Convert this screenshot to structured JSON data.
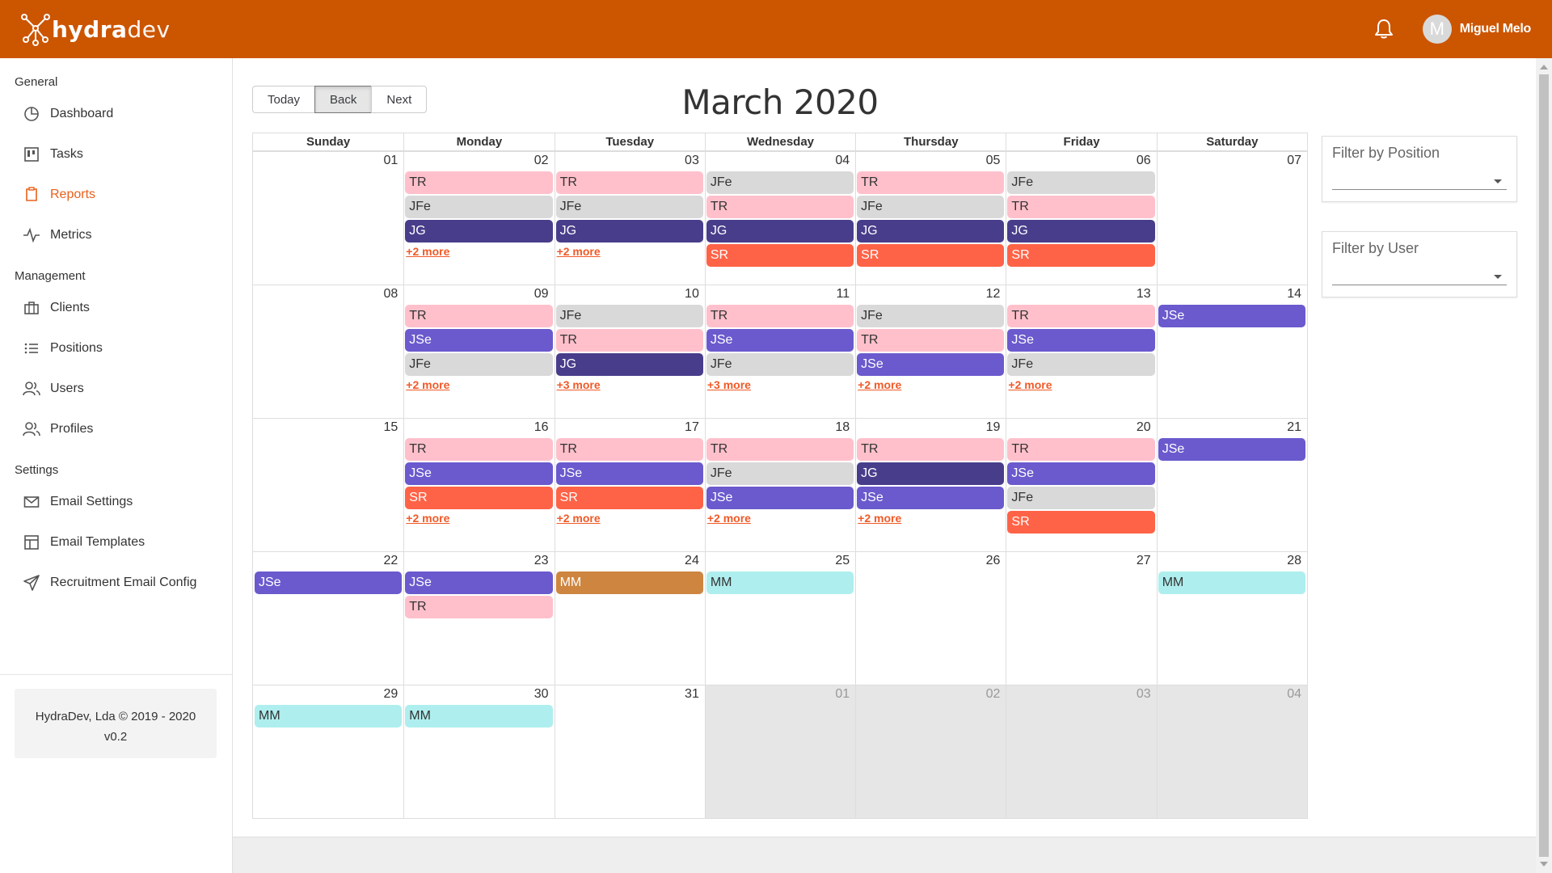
{
  "header": {
    "logo_bold": "hydra",
    "logo_light": "dev",
    "user_initial": "M",
    "user_name": "Miguel Melo"
  },
  "sidebar": {
    "sections": [
      {
        "title": "General",
        "items": [
          {
            "label": "Dashboard",
            "icon": "pie-chart-icon"
          },
          {
            "label": "Tasks",
            "icon": "kanban-icon"
          },
          {
            "label": "Reports",
            "icon": "report-icon",
            "active": true
          },
          {
            "label": "Metrics",
            "icon": "activity-icon"
          }
        ]
      },
      {
        "title": "Management",
        "items": [
          {
            "label": "Clients",
            "icon": "briefcase-icon"
          },
          {
            "label": "Positions",
            "icon": "list-icon"
          },
          {
            "label": "Users",
            "icon": "users-icon"
          },
          {
            "label": "Profiles",
            "icon": "users-icon"
          }
        ]
      },
      {
        "title": "Settings",
        "items": [
          {
            "label": "Email Settings",
            "icon": "mail-icon"
          },
          {
            "label": "Email Templates",
            "icon": "template-icon"
          },
          {
            "label": "Recruitment Email Config",
            "icon": "send-icon"
          }
        ]
      }
    ],
    "footer_line1": "HydraDev, Lda © 2019 - 2020",
    "footer_line2": "v0.2"
  },
  "toolbar": {
    "today_label": "Today",
    "back_label": "Back",
    "next_label": "Next",
    "title": "March 2020"
  },
  "filters": {
    "position_label": "Filter by Position",
    "user_label": "Filter by User"
  },
  "colors": {
    "accent": "#cc5500",
    "TR": "#ffc0cb",
    "JFe": "#d9d9d9",
    "JG": "#483d8b",
    "SR": "#ff6347",
    "JSe": "#6a5acd",
    "MM_cyan": "#afeeee",
    "MM_orange": "#cd853f"
  },
  "calendar": {
    "weekdays": [
      "Sunday",
      "Monday",
      "Tuesday",
      "Wednesday",
      "Thursday",
      "Friday",
      "Saturday"
    ],
    "weeks": [
      [
        {
          "num": "01",
          "events": []
        },
        {
          "num": "02",
          "events": [
            "TR",
            "JFe",
            "JG"
          ],
          "more": "+2 more"
        },
        {
          "num": "03",
          "events": [
            "TR",
            "JFe",
            "JG"
          ],
          "more": "+2 more"
        },
        {
          "num": "04",
          "events": [
            "JFe",
            "TR",
            "JG",
            "SR"
          ]
        },
        {
          "num": "05",
          "events": [
            "TR",
            "JFe",
            "JG",
            "SR"
          ]
        },
        {
          "num": "06",
          "events": [
            "JFe",
            "TR",
            "JG",
            "SR"
          ]
        },
        {
          "num": "07",
          "events": []
        }
      ],
      [
        {
          "num": "08",
          "events": []
        },
        {
          "num": "09",
          "events": [
            "TR",
            "JSe",
            "JFe"
          ],
          "more": "+2 more"
        },
        {
          "num": "10",
          "events": [
            "JFe",
            "TR",
            "JG"
          ],
          "more": "+3 more"
        },
        {
          "num": "11",
          "events": [
            "TR",
            "JSe",
            "JFe"
          ],
          "more": "+3 more"
        },
        {
          "num": "12",
          "events": [
            "JFe",
            "TR",
            "JSe"
          ],
          "more": "+2 more"
        },
        {
          "num": "13",
          "events": [
            "TR",
            "JSe",
            "JFe"
          ],
          "more": "+2 more"
        },
        {
          "num": "14",
          "events": [
            "JSe"
          ]
        }
      ],
      [
        {
          "num": "15",
          "events": []
        },
        {
          "num": "16",
          "events": [
            "TR",
            "JSe",
            "SR"
          ],
          "more": "+2 more"
        },
        {
          "num": "17",
          "events": [
            "TR",
            "JSe",
            "SR"
          ],
          "more": "+2 more"
        },
        {
          "num": "18",
          "events": [
            "TR",
            "JFe",
            "JSe"
          ],
          "more": "+2 more"
        },
        {
          "num": "19",
          "events": [
            "TR",
            "JG",
            "JSe"
          ],
          "more": "+2 more"
        },
        {
          "num": "20",
          "events": [
            "TR",
            "JSe",
            "JFe",
            "SR"
          ]
        },
        {
          "num": "21",
          "events": [
            "JSe"
          ]
        }
      ],
      [
        {
          "num": "22",
          "events": [
            "JSe"
          ]
        },
        {
          "num": "23",
          "events": [
            "JSe",
            "TR"
          ]
        },
        {
          "num": "24",
          "events": [
            "MM_orange"
          ]
        },
        {
          "num": "25",
          "events": [
            "MM"
          ]
        },
        {
          "num": "26",
          "events": []
        },
        {
          "num": "27",
          "events": []
        },
        {
          "num": "28",
          "events": [
            "MM"
          ]
        }
      ],
      [
        {
          "num": "29",
          "events": [
            "MM"
          ]
        },
        {
          "num": "30",
          "events": [
            "MM"
          ]
        },
        {
          "num": "31",
          "events": []
        },
        {
          "num": "01",
          "events": [],
          "off": true
        },
        {
          "num": "02",
          "events": [],
          "off": true
        },
        {
          "num": "03",
          "events": [],
          "off": true
        },
        {
          "num": "04",
          "events": [],
          "off": true
        }
      ]
    ]
  }
}
